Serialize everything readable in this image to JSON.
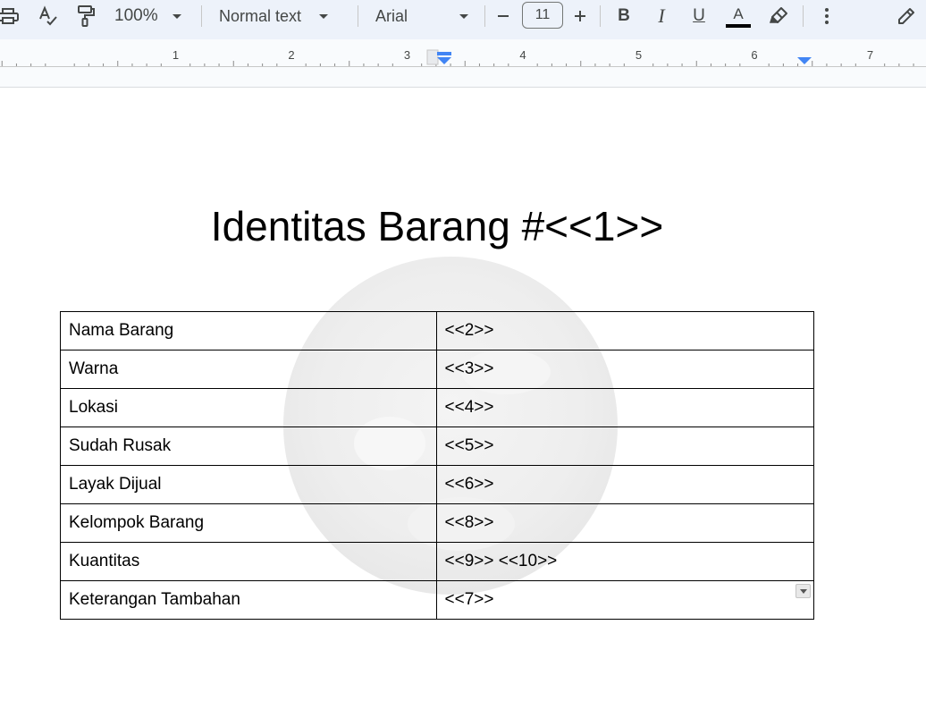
{
  "toolbar": {
    "zoom": "100%",
    "style": "Normal text",
    "font": "Arial",
    "font_size": "11",
    "icons": [
      "print-icon",
      "spellcheck-icon",
      "paint-format-icon",
      "bold-icon",
      "italic-icon",
      "underline-icon",
      "text-color-icon",
      "highlight-icon",
      "more-icon",
      "edit-mode-icon"
    ],
    "bold_label": "B",
    "italic_label": "I",
    "underline_label": "U",
    "text_color_label": "A",
    "text_color": "#000000",
    "accent": "#4285f4"
  },
  "ruler": {
    "numbers": [
      "1",
      "2",
      "3",
      "4",
      "5",
      "6",
      "7"
    ]
  },
  "document": {
    "title": "Identitas Barang #<<1>>",
    "rows": [
      {
        "label": "Nama Barang",
        "value": "<<2>>"
      },
      {
        "label": "Warna",
        "value": "<<3>>"
      },
      {
        "label": "Lokasi",
        "value": "<<4>>"
      },
      {
        "label": "Sudah Rusak",
        "value": "<<5>>"
      },
      {
        "label": "Layak Dijual",
        "value": "<<6>>"
      },
      {
        "label": "Kelompok Barang",
        "value": "<<8>>"
      },
      {
        "label": "Kuantitas",
        "value": "<<9>> <<10>>"
      },
      {
        "label": "Keterangan Tambahan",
        "value": "<<7>>"
      }
    ]
  }
}
